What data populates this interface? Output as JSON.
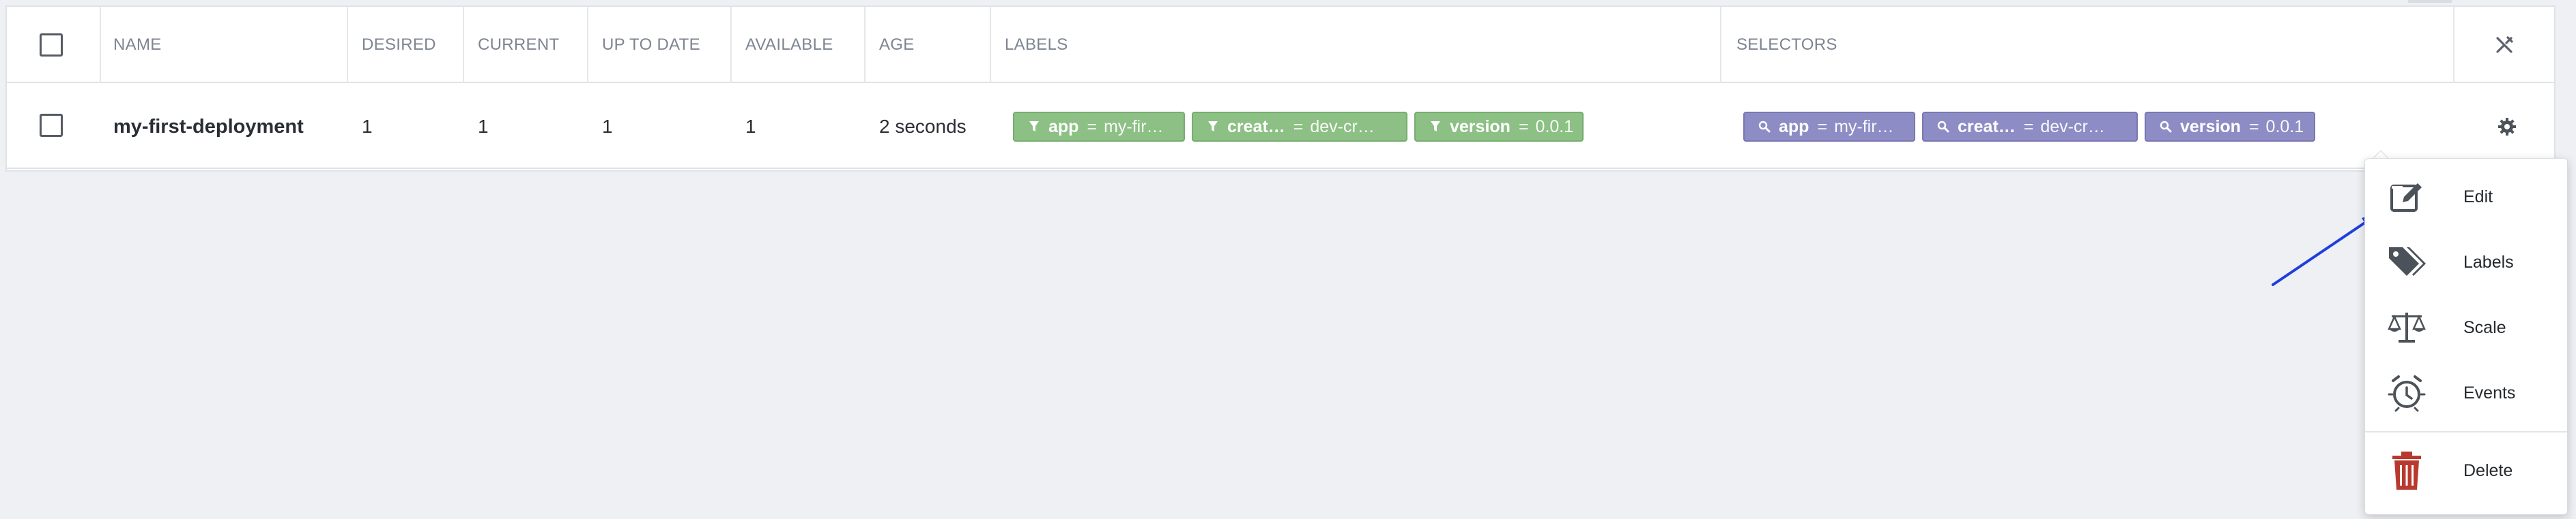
{
  "table": {
    "columns": [
      "NAME",
      "DESIRED",
      "CURRENT",
      "UP TO DATE",
      "AVAILABLE",
      "AGE",
      "LABELS",
      "SELECTORS"
    ],
    "rows": [
      {
        "name": "my-first-deployment",
        "desired": "1",
        "current": "1",
        "up_to_date": "1",
        "available": "1",
        "age": "2 seconds",
        "labels": [
          {
            "key": "app",
            "eq": "=",
            "value": "my-fir…"
          },
          {
            "key": "creat…",
            "eq": "=",
            "value": "dev-cr…"
          },
          {
            "key": "version",
            "eq": "=",
            "value": "0.0.1"
          }
        ],
        "selectors": [
          {
            "key": "app",
            "eq": "=",
            "value": "my-fir…"
          },
          {
            "key": "creat…",
            "eq": "=",
            "value": "dev-cr…"
          },
          {
            "key": "version",
            "eq": "=",
            "value": "0.0.1"
          }
        ]
      }
    ]
  },
  "menu": {
    "items": [
      {
        "label": "Edit",
        "icon": "edit-icon"
      },
      {
        "label": "Labels",
        "icon": "tags-icon"
      },
      {
        "label": "Scale",
        "icon": "balance-scale-icon"
      },
      {
        "label": "Events",
        "icon": "alarm-clock-icon"
      },
      {
        "label": "Delete",
        "icon": "trash-icon"
      }
    ]
  },
  "colors": {
    "label_chip": "#8cc084",
    "selector_chip": "#8d8cc4",
    "delete_icon": "#b83a2e",
    "annotation_arrow": "#1f3fdc"
  }
}
